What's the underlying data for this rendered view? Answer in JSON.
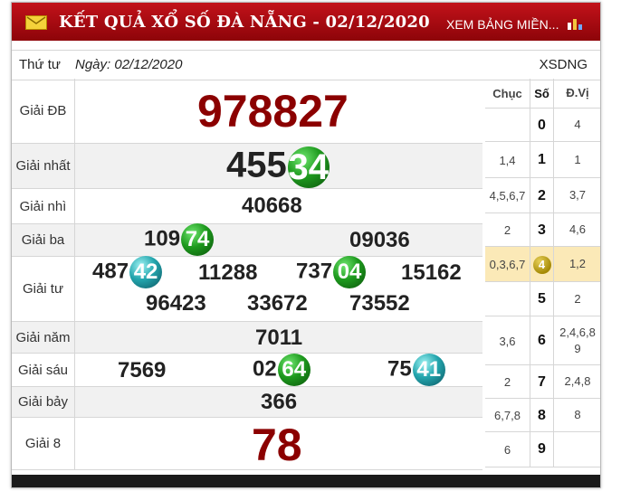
{
  "header": {
    "title": "KẾT QUẢ XỔ SỐ ĐÀ NẴNG - 02/12/2020",
    "link": "XEM BẢNG MIỀN..."
  },
  "subbar": {
    "weekday": "Thứ tư",
    "date": "Ngày: 02/12/2020",
    "code": "XSDNG"
  },
  "prizes": {
    "db": {
      "label": "Giải ĐB",
      "number": "978827"
    },
    "nhat": {
      "label": "Giải nhất",
      "plain": "455",
      "ball": "34"
    },
    "nhi": {
      "label": "Giải nhì",
      "number": "40668"
    },
    "ba": {
      "label": "Giải ba",
      "n1_plain": "109",
      "n1_ball": "74",
      "n2": "09036"
    },
    "tu": {
      "label": "Giải tư",
      "n1_plain": "487",
      "n1_ball": "42",
      "n2": "11288",
      "n3_plain": "737",
      "n3_ball": "04",
      "n4": "15162",
      "n5": "96423",
      "n6": "33672",
      "n7": "73552"
    },
    "nam": {
      "label": "Giải năm",
      "number": "7011"
    },
    "sau": {
      "label": "Giải sáu",
      "n1": "7569",
      "n2_plain": "02",
      "n2_ball": "64",
      "n3_plain": "75",
      "n3_ball": "41"
    },
    "bay": {
      "label": "Giải bảy",
      "number": "366"
    },
    "tam": {
      "label": "Giải 8",
      "number": "78"
    }
  },
  "loto": {
    "headers": {
      "chuc": "Chục",
      "so": "Số",
      "dvi": "Đ.Vị"
    },
    "rows": [
      {
        "chuc": "",
        "so": "0",
        "dvi": "4"
      },
      {
        "chuc": "1,4",
        "so": "1",
        "dvi": "1"
      },
      {
        "chuc": "4,5,6,7",
        "so": "2",
        "dvi": "3,7"
      },
      {
        "chuc": "2",
        "so": "3",
        "dvi": "4,6"
      },
      {
        "chuc": "0,3,6,7",
        "so": "4",
        "dvi": "1,2"
      },
      {
        "chuc": "",
        "so": "5",
        "dvi": "2"
      },
      {
        "chuc": "3,6",
        "so": "6",
        "dvi": "2,4,6,8 9"
      },
      {
        "chuc": "2",
        "so": "7",
        "dvi": "2,4,8"
      },
      {
        "chuc": "6,7,8",
        "so": "8",
        "dvi": "8"
      },
      {
        "chuc": "6",
        "so": "9",
        "dvi": ""
      }
    ]
  },
  "colors": {
    "header_red": "#b00a10",
    "jackpot_red": "#8b0000",
    "ball_green": "#1e9a1e",
    "ball_cyan": "#23a5ad",
    "highlight": "#fbe9b7"
  }
}
